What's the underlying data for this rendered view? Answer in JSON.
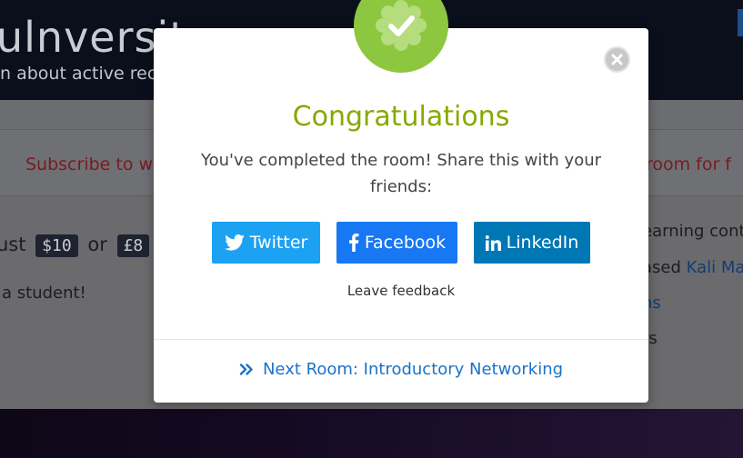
{
  "background": {
    "site_title": "ulnversity",
    "site_subtitle": "n about active recor",
    "subscribe_left": "Subscribe to wa",
    "subscribe_right": "s room for f",
    "price_prefix": "ust",
    "price_usd": "$10",
    "price_or": "or",
    "price_gbp": "£8",
    "student_text": "a student!",
    "right_line_1": "earning cont",
    "right_line_2_prefix": "ased ",
    "right_line_2_link": "Kali Ma",
    "right_line_3_link": "hs",
    "right_line_4": "rs"
  },
  "modal": {
    "badge_icon": "check-badge-icon",
    "close_icon": "close-icon",
    "title": "Congratulations",
    "message": "You've completed the room! Share this with your friends:",
    "share": {
      "twitter_label": "Twitter",
      "facebook_label": "Facebook",
      "linkedin_label": "LinkedIn"
    },
    "feedback_label": "Leave feedback",
    "next_room_label": "Next Room: Introductory Networking"
  },
  "colors": {
    "badge_green": "#8dc63f",
    "title_green": "#88a800",
    "twitter_blue": "#1da1f2",
    "facebook_blue": "#1877f2",
    "linkedin_blue": "#0077b5",
    "link_blue": "#1a73c8",
    "alert_red": "#c4343f"
  }
}
